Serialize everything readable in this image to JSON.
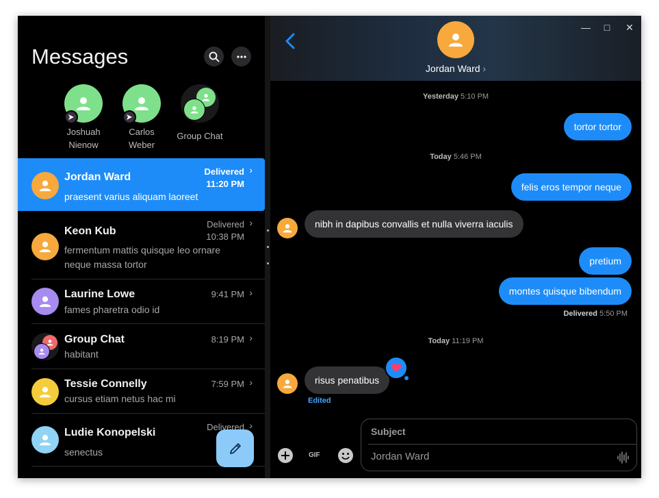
{
  "sidebar": {
    "title": "Messages",
    "pinned": [
      {
        "name": "Joshuah Nienow"
      },
      {
        "name": "Carlos Weber"
      },
      {
        "name": "Group Chat"
      }
    ],
    "conversations": [
      {
        "name": "Jordan Ward",
        "snippet": "praesent varius aliquam laoreet",
        "status": "Delivered",
        "time": "11:20 PM",
        "active": true
      },
      {
        "name": "Keon Kub",
        "snippet": "fermentum mattis quisque leo ornare neque massa tortor",
        "status": "Delivered",
        "time": "10:38 PM"
      },
      {
        "name": "Laurine Lowe",
        "snippet": "fames pharetra odio id",
        "time": "9:41 PM"
      },
      {
        "name": "Group Chat",
        "snippet": "habitant",
        "time": "8:19 PM"
      },
      {
        "name": "Tessie Connelly",
        "snippet": "cursus etiam netus hac mi",
        "time": "7:59 PM"
      },
      {
        "name": "Ludie Konopelski",
        "snippet": "senectus",
        "status": "Delivered",
        "time": "6"
      }
    ]
  },
  "chat": {
    "contact_name": "Jordan Ward",
    "timestamps": [
      {
        "day": "Yesterday",
        "time": "5:10 PM"
      },
      {
        "day": "Today",
        "time": "5:46 PM"
      },
      {
        "day": "Today",
        "time": "11:19 PM"
      }
    ],
    "messages": [
      {
        "text": "tortor tortor",
        "direction": "out"
      },
      {
        "text": "felis eros tempor neque",
        "direction": "out"
      },
      {
        "text": "nibh in dapibus convallis et nulla viverra iaculis",
        "direction": "in"
      },
      {
        "text": "pretium",
        "direction": "out"
      },
      {
        "text": "montes quisque bibendum",
        "direction": "out"
      },
      {
        "text": "risus penatibus",
        "direction": "in"
      }
    ],
    "delivered_label": "Delivered",
    "delivered_time": "5:50 PM",
    "edited_label": "Edited",
    "composer": {
      "subject_placeholder": "Subject",
      "message_placeholder": "Jordan Ward",
      "gif_label": "GIF"
    }
  },
  "colors": {
    "accent": "#1d8cf8",
    "incoming_bubble": "#333335",
    "background": "#000000"
  },
  "icons": [
    "search-icon",
    "more-icon",
    "back-icon",
    "compose-icon",
    "plus-icon",
    "emoji-icon",
    "waveform-icon",
    "heart-icon"
  ]
}
